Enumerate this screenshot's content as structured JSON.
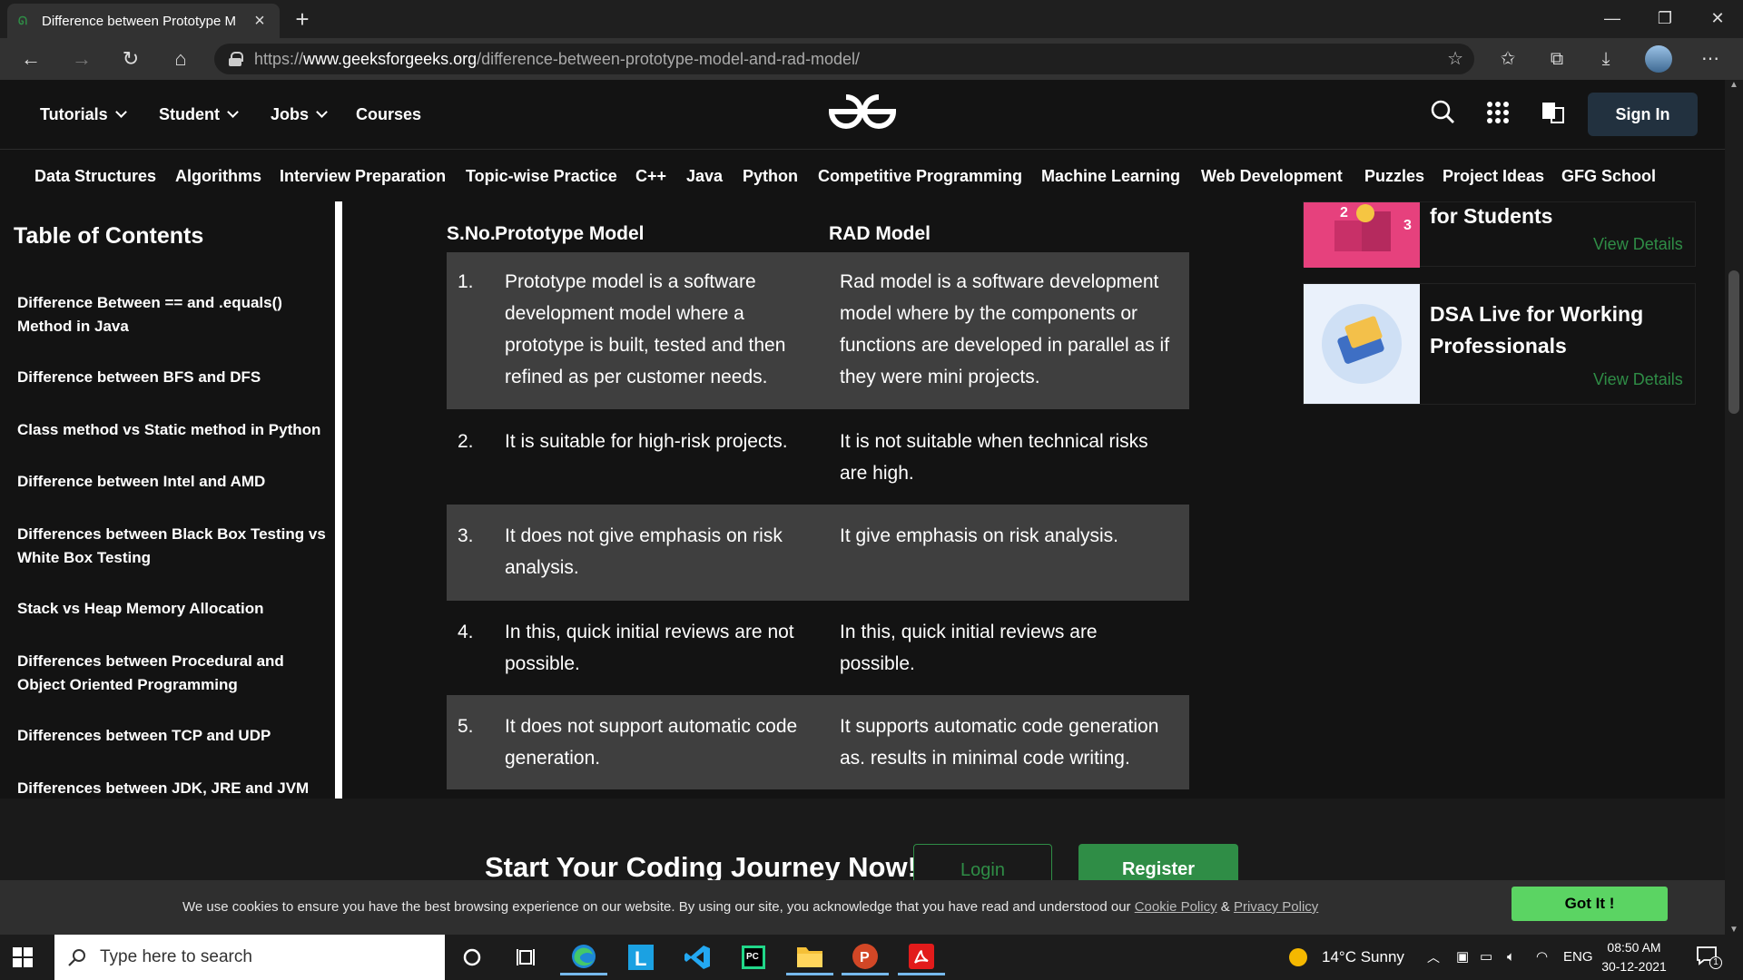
{
  "browser": {
    "tab_title": "Difference between Prototype M",
    "new_tab": "+",
    "url_prefix": "https://",
    "url_host": "www.geeksforgeeks.org",
    "url_path": "/difference-between-prototype-model-and-rad-model/"
  },
  "header": {
    "nav": [
      {
        "label": "Tutorials",
        "dropdown": true
      },
      {
        "label": "Student",
        "dropdown": true
      },
      {
        "label": "Jobs",
        "dropdown": true
      },
      {
        "label": "Courses",
        "dropdown": false
      }
    ],
    "sign_in": "Sign In"
  },
  "subnav": [
    "Data Structures",
    "Algorithms",
    "Interview Preparation",
    "Topic-wise Practice",
    "C++",
    "Java",
    "Python",
    "Competitive Programming",
    "Machine Learning",
    "Web Development",
    "Puzzles",
    "Project Ideas",
    "GFG School"
  ],
  "toc": {
    "title": "Table of Contents",
    "items": [
      "Difference Between == and .equals() Method in Java",
      "Difference between BFS and DFS",
      "Class method vs Static method in Python",
      "Difference between Intel and AMD",
      "Differences between Black Box Testing vs White Box Testing",
      "Stack vs Heap Memory Allocation",
      "Differences between Procedural and Object Oriented Programming",
      "Differences between TCP and UDP",
      "Differences between JDK, JRE and JVM"
    ]
  },
  "table": {
    "headers": [
      "S.No.",
      "Prototype Model",
      "RAD Model"
    ],
    "rows": [
      {
        "sno": "1.",
        "prototype": "Prototype model is a software development model where a prototype is built, tested and then refined as per customer needs.",
        "rad": "Rad model is a software development model where by the components or functions are developed in parallel as if they were mini projects."
      },
      {
        "sno": "2.",
        "prototype": "It is suitable for high-risk projects.",
        "rad": "It is not suitable when technical risks are high."
      },
      {
        "sno": "3.",
        "prototype": "It does not give emphasis on risk analysis.",
        "rad": "It give emphasis on risk analysis."
      },
      {
        "sno": "4.",
        "prototype": "In this, quick initial reviews are not possible.",
        "rad": "In this, quick initial reviews are possible."
      },
      {
        "sno": "5.",
        "prototype": "It does not support automatic code generation.",
        "rad": "It supports automatic code generation as. results in minimal code writing."
      }
    ]
  },
  "cards": [
    {
      "title": "for Students",
      "link": "View Details"
    },
    {
      "title": "DSA Live for Working Professionals",
      "link": "View Details"
    }
  ],
  "cta": {
    "title": "Start Your Coding Journey Now!",
    "login": "Login",
    "register": "Register"
  },
  "cookie": {
    "message": "We use cookies to ensure you have the best browsing experience on our website. By using our site, you acknowledge that you have read and understood our",
    "cookie_policy": "Cookie Policy",
    "amp": "&",
    "privacy_policy": "Privacy Policy",
    "button": "Got It !"
  },
  "taskbar": {
    "search_placeholder": "Type here to search",
    "weather": "14°C  Sunny",
    "lang": "ENG",
    "time": "08:50 AM",
    "date": "30-12-2021",
    "notification_count": "1"
  },
  "colors": {
    "gfg_green": "#2f8d46",
    "got_it_green": "#5bd463",
    "row_shade": "#3f3f3f",
    "page_bg": "#131313"
  }
}
